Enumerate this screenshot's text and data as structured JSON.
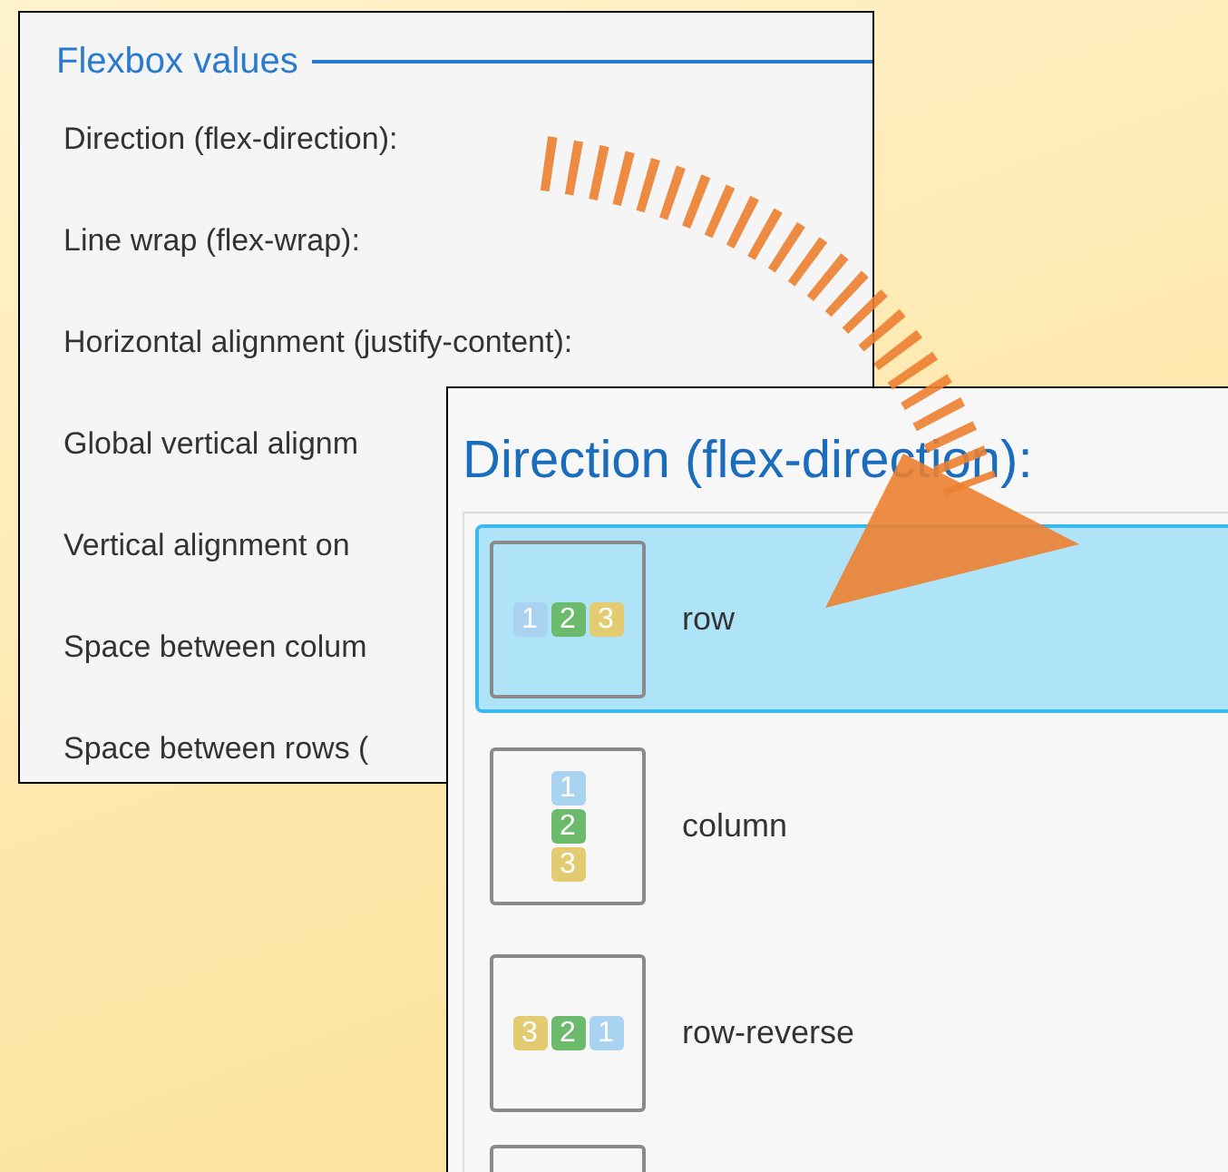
{
  "settings_panel": {
    "title": "Flexbox values",
    "labels": [
      "Direction (flex-direction):",
      "Line wrap (flex-wrap):",
      "Horizontal alignment (justify-content):",
      "Global vertical alignm",
      "Vertical alignment on",
      "Space between colum",
      "Space between rows ("
    ]
  },
  "direction_picker": {
    "title": "Direction (flex-direction):",
    "options": [
      {
        "label": "row",
        "kind": "row",
        "selected": true,
        "blocks": [
          {
            "text": "1",
            "color": "#a9d3f1"
          },
          {
            "text": "2",
            "color": "#6cba6c"
          },
          {
            "text": "3",
            "color": "#e2cb70"
          }
        ]
      },
      {
        "label": "column",
        "kind": "column",
        "selected": false,
        "blocks": [
          {
            "text": "1",
            "color": "#a9d3f1"
          },
          {
            "text": "2",
            "color": "#6cba6c"
          },
          {
            "text": "3",
            "color": "#e2cb70"
          }
        ]
      },
      {
        "label": "row-reverse",
        "kind": "row",
        "selected": false,
        "blocks": [
          {
            "text": "3",
            "color": "#e2cb70"
          },
          {
            "text": "2",
            "color": "#6cba6c"
          },
          {
            "text": "1",
            "color": "#a9d3f1"
          }
        ]
      }
    ]
  }
}
